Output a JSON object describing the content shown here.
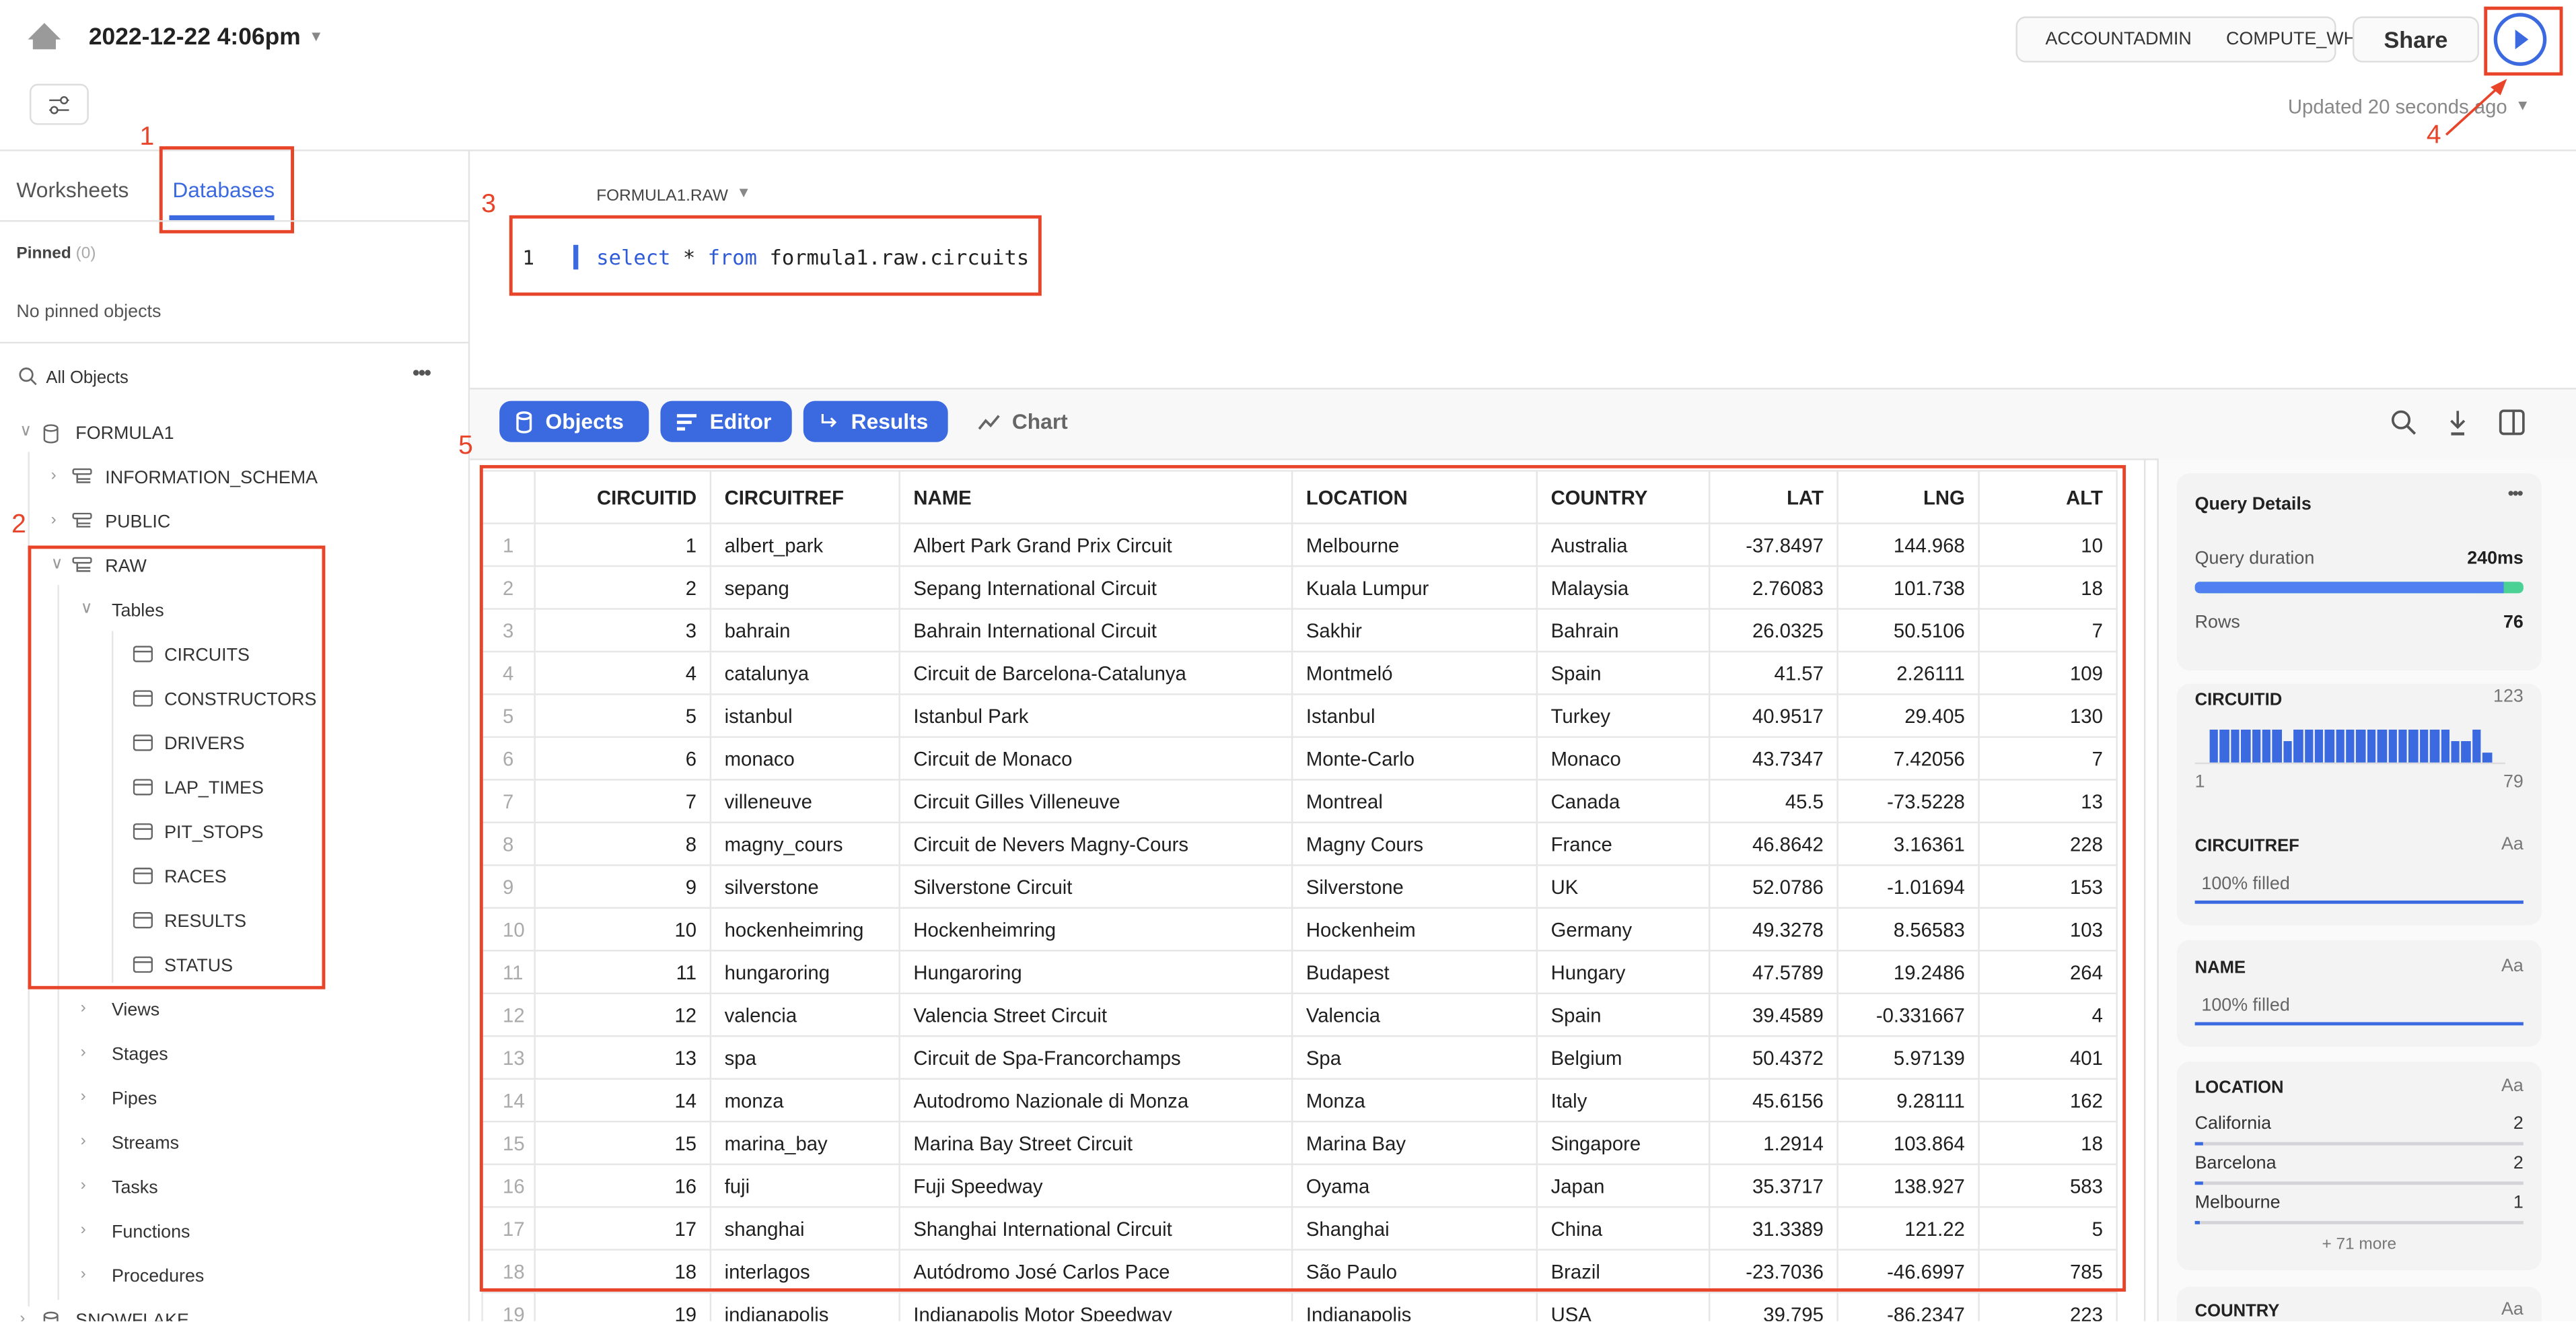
{
  "header": {
    "title": "2022-12-22 4:06pm",
    "role": "ACCOUNTADMIN",
    "warehouse": "COMPUTE_WH",
    "share_label": "Share",
    "updated": "Updated 20 seconds ago",
    "warehouse_status_color": "#4cc38a",
    "accent": "#3b6ae0"
  },
  "annotations": [
    "1",
    "2",
    "3",
    "4",
    "5"
  ],
  "sidebar": {
    "tabs": [
      {
        "label": "Worksheets",
        "active": false
      },
      {
        "label": "Databases",
        "active": true
      }
    ],
    "pinned_label": "Pinned",
    "pinned_count": "(0)",
    "no_pinned": "No pinned objects",
    "all_objects": "All Objects",
    "tree": [
      {
        "label": "FORMULA1",
        "level": 0,
        "icon": "database-icon",
        "chevron": "down"
      },
      {
        "label": "INFORMATION_SCHEMA",
        "level": 1,
        "icon": "schema-icon",
        "chevron": "right"
      },
      {
        "label": "PUBLIC",
        "level": 1,
        "icon": "schema-icon",
        "chevron": "right"
      },
      {
        "label": "RAW",
        "level": 1,
        "icon": "schema-icon",
        "chevron": "down"
      },
      {
        "label": "Tables",
        "level": 2,
        "chevron": "down"
      },
      {
        "label": "CIRCUITS",
        "level": 3,
        "icon": "table-icon"
      },
      {
        "label": "CONSTRUCTORS",
        "level": 3,
        "icon": "table-icon"
      },
      {
        "label": "DRIVERS",
        "level": 3,
        "icon": "table-icon"
      },
      {
        "label": "LAP_TIMES",
        "level": 3,
        "icon": "table-icon"
      },
      {
        "label": "PIT_STOPS",
        "level": 3,
        "icon": "table-icon"
      },
      {
        "label": "RACES",
        "level": 3,
        "icon": "table-icon"
      },
      {
        "label": "RESULTS",
        "level": 3,
        "icon": "table-icon"
      },
      {
        "label": "STATUS",
        "level": 3,
        "icon": "table-icon"
      },
      {
        "label": "Views",
        "level": 2,
        "chevron": "right"
      },
      {
        "label": "Stages",
        "level": 2,
        "chevron": "right"
      },
      {
        "label": "Pipes",
        "level": 2,
        "chevron": "right"
      },
      {
        "label": "Streams",
        "level": 2,
        "chevron": "right"
      },
      {
        "label": "Tasks",
        "level": 2,
        "chevron": "right"
      },
      {
        "label": "Functions",
        "level": 2,
        "chevron": "right"
      },
      {
        "label": "Procedures",
        "level": 2,
        "chevron": "right"
      },
      {
        "label": "SNOWFLAKE",
        "level": 0,
        "icon": "database-icon",
        "chevron": "right"
      }
    ]
  },
  "editor": {
    "context": "FORMULA1.RAW",
    "line_number": "1",
    "kw1": "select",
    "star": " * ",
    "kw2": "from",
    "rest": " formula1.raw.circuits"
  },
  "toolbar": {
    "objects": "Objects",
    "editor": "Editor",
    "results": "Results",
    "chart": "Chart"
  },
  "results": {
    "columns": [
      "CIRCUITID",
      "CIRCUITREF",
      "NAME",
      "LOCATION",
      "COUNTRY",
      "LAT",
      "LNG",
      "ALT"
    ],
    "rows": [
      [
        "1",
        "albert_park",
        "Albert Park Grand Prix Circuit",
        "Melbourne",
        "Australia",
        "-37.8497",
        "144.968",
        "10"
      ],
      [
        "2",
        "sepang",
        "Sepang International Circuit",
        "Kuala Lumpur",
        "Malaysia",
        "2.76083",
        "101.738",
        "18"
      ],
      [
        "3",
        "bahrain",
        "Bahrain International Circuit",
        "Sakhir",
        "Bahrain",
        "26.0325",
        "50.5106",
        "7"
      ],
      [
        "4",
        "catalunya",
        "Circuit de Barcelona-Catalunya",
        "Montmeló",
        "Spain",
        "41.57",
        "2.26111",
        "109"
      ],
      [
        "5",
        "istanbul",
        "Istanbul Park",
        "Istanbul",
        "Turkey",
        "40.9517",
        "29.405",
        "130"
      ],
      [
        "6",
        "monaco",
        "Circuit de Monaco",
        "Monte-Carlo",
        "Monaco",
        "43.7347",
        "7.42056",
        "7"
      ],
      [
        "7",
        "villeneuve",
        "Circuit Gilles Villeneuve",
        "Montreal",
        "Canada",
        "45.5",
        "-73.5228",
        "13"
      ],
      [
        "8",
        "magny_cours",
        "Circuit de Nevers Magny-Cours",
        "Magny Cours",
        "France",
        "46.8642",
        "3.16361",
        "228"
      ],
      [
        "9",
        "silverstone",
        "Silverstone Circuit",
        "Silverstone",
        "UK",
        "52.0786",
        "-1.01694",
        "153"
      ],
      [
        "10",
        "hockenheimring",
        "Hockenheimring",
        "Hockenheim",
        "Germany",
        "49.3278",
        "8.56583",
        "103"
      ],
      [
        "11",
        "hungaroring",
        "Hungaroring",
        "Budapest",
        "Hungary",
        "47.5789",
        "19.2486",
        "264"
      ],
      [
        "12",
        "valencia",
        "Valencia Street Circuit",
        "Valencia",
        "Spain",
        "39.4589",
        "-0.331667",
        "4"
      ],
      [
        "13",
        "spa",
        "Circuit de Spa-Francorchamps",
        "Spa",
        "Belgium",
        "50.4372",
        "5.97139",
        "401"
      ],
      [
        "14",
        "monza",
        "Autodromo Nazionale di Monza",
        "Monza",
        "Italy",
        "45.6156",
        "9.28111",
        "162"
      ],
      [
        "15",
        "marina_bay",
        "Marina Bay Street Circuit",
        "Marina Bay",
        "Singapore",
        "1.2914",
        "103.864",
        "18"
      ],
      [
        "16",
        "fuji",
        "Fuji Speedway",
        "Oyama",
        "Japan",
        "35.3717",
        "138.927",
        "583"
      ],
      [
        "17",
        "shanghai",
        "Shanghai International Circuit",
        "Shanghai",
        "China",
        "31.3389",
        "121.22",
        "5"
      ],
      [
        "18",
        "interlagos",
        "Autódromo José Carlos Pace",
        "São Paulo",
        "Brazil",
        "-23.7036",
        "-46.6997",
        "785"
      ],
      [
        "19",
        "indianapolis",
        "Indianapolis Motor Speedway",
        "Indianapolis",
        "USA",
        "39.795",
        "-86.2347",
        "223"
      ]
    ]
  },
  "details": {
    "title": "Query Details",
    "duration_label": "Query duration",
    "duration": "240ms",
    "duration_fraction": 0.94,
    "rows_label": "Rows",
    "rows": "76",
    "circuitid": {
      "name": "CIRCUITID",
      "type": "123",
      "min": "1",
      "max": "79",
      "histogram": [
        1,
        1,
        1,
        1,
        1,
        1,
        1,
        0.65,
        1,
        1,
        1,
        1,
        1,
        1,
        1,
        1,
        1,
        1,
        1,
        1,
        1,
        1,
        1,
        0.65,
        0.65,
        1,
        0.3
      ]
    },
    "circuitref": {
      "name": "CIRCUITREF",
      "type": "Aa",
      "filled": "100% filled",
      "fill_fraction": 1
    },
    "name": {
      "name": "NAME",
      "type": "Aa",
      "filled": "100% filled",
      "fill_fraction": 1
    },
    "location": {
      "name": "LOCATION",
      "type": "Aa",
      "top": [
        {
          "label": "California",
          "count": "2",
          "fraction": 0.027
        },
        {
          "label": "Barcelona",
          "count": "2",
          "fraction": 0.027
        },
        {
          "label": "Melbourne",
          "count": "1",
          "fraction": 0.013
        }
      ],
      "more": "+ 71 more"
    },
    "country": {
      "name": "COUNTRY",
      "type": "Aa"
    }
  }
}
